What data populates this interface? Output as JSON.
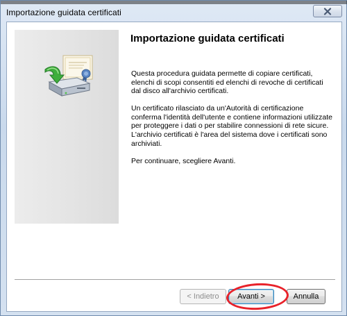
{
  "window": {
    "title": "Importazione guidata certificati"
  },
  "wizard": {
    "heading": "Importazione guidata certificati",
    "paragraphs": [
      "Questa procedura guidata permette di copiare certificati, elenchi di scopi consentiti ed elenchi di revoche di certificati dal disco all'archivio certificati.",
      "Un certificato rilasciato da un'Autorità di certificazione conferma l'identità dell'utente e contiene informazioni utilizzate per proteggere i dati o per stabilire connessioni di rete sicure. L'archivio certificati è l'area del sistema dove i certificati sono archiviati.",
      "Per continuare, scegliere Avanti."
    ]
  },
  "buttons": {
    "back": "< Indietro",
    "next": "Avanti >",
    "cancel": "Annulla"
  },
  "icons": {
    "close": "close-icon",
    "wizard": "certificate-import-icon"
  },
  "colors": {
    "highlight": "#e8222a",
    "title_frame": "#c9d9ec"
  }
}
